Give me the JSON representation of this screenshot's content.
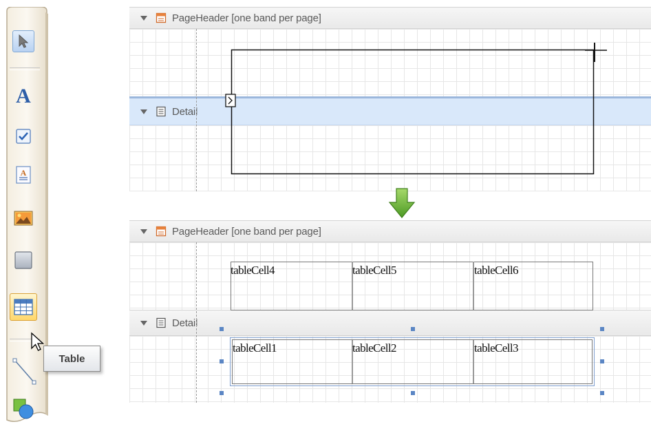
{
  "toolbox": {
    "items": [
      {
        "name": "pointer",
        "icon": "pointer-icon"
      },
      {
        "name": "label",
        "icon": "label-a-icon"
      },
      {
        "name": "checkbox",
        "icon": "checkbox-icon"
      },
      {
        "name": "richtext",
        "icon": "richtext-icon"
      },
      {
        "name": "picturebox",
        "icon": "picture-icon"
      },
      {
        "name": "panel",
        "icon": "panel-icon"
      },
      {
        "name": "table",
        "icon": "table-icon"
      },
      {
        "name": "line",
        "icon": "line-icon"
      },
      {
        "name": "shape",
        "icon": "shape-icon"
      }
    ],
    "tooltip": "Table"
  },
  "before": {
    "page_header_label": "PageHeader [one band per page]",
    "detail_label": "Detail"
  },
  "after": {
    "page_header_label": "PageHeader [one band per page]",
    "detail_label": "Detail",
    "header_row": [
      "tableCell4",
      "tableCell5",
      "tableCell6"
    ],
    "detail_row": [
      "tableCell1",
      "tableCell2",
      "tableCell3"
    ]
  },
  "colors": {
    "selected_band": "#d9e8fa",
    "selection_handle": "#5b86c4",
    "transition_arrow": "#6db33f"
  }
}
